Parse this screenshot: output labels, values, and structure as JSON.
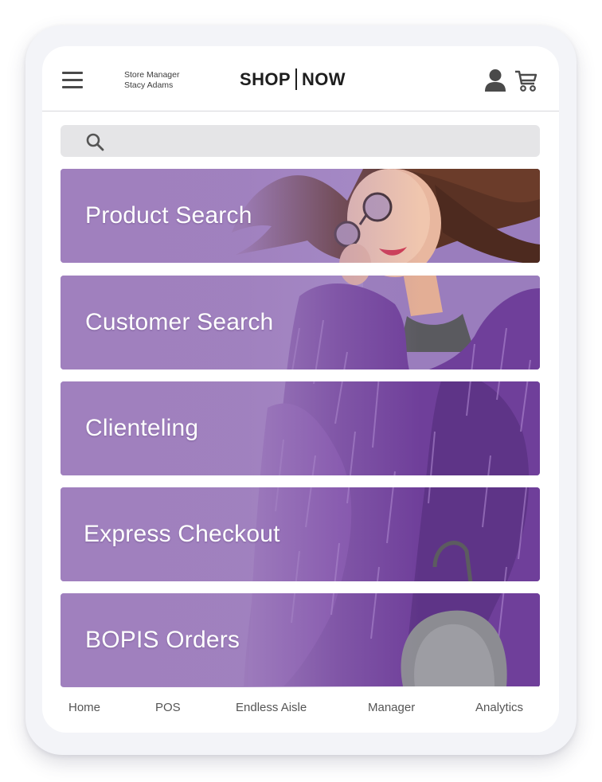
{
  "header": {
    "role": "Store Manager",
    "user_name": "Stacy Adams",
    "brand_left": "SHOP",
    "brand_right": "NOW",
    "menu_icon": "hamburger-menu-icon",
    "profile_icon": "person-icon",
    "cart_icon": "cart-icon"
  },
  "search": {
    "icon": "search-icon",
    "value": "",
    "placeholder": ""
  },
  "tiles": [
    {
      "label": "Product Search"
    },
    {
      "label": "Customer Search"
    },
    {
      "label": "Clienteling"
    },
    {
      "label": "Express Checkout"
    },
    {
      "label": "BOPIS Orders"
    }
  ],
  "bottom_nav": [
    {
      "label": "Home"
    },
    {
      "label": "POS"
    },
    {
      "label": "Endless Aisle"
    },
    {
      "label": "Manager"
    },
    {
      "label": "Analytics"
    }
  ],
  "colors": {
    "tile_purple": "#a080be",
    "coat_purple": "#6f3f9a",
    "background": "#ffffff"
  }
}
